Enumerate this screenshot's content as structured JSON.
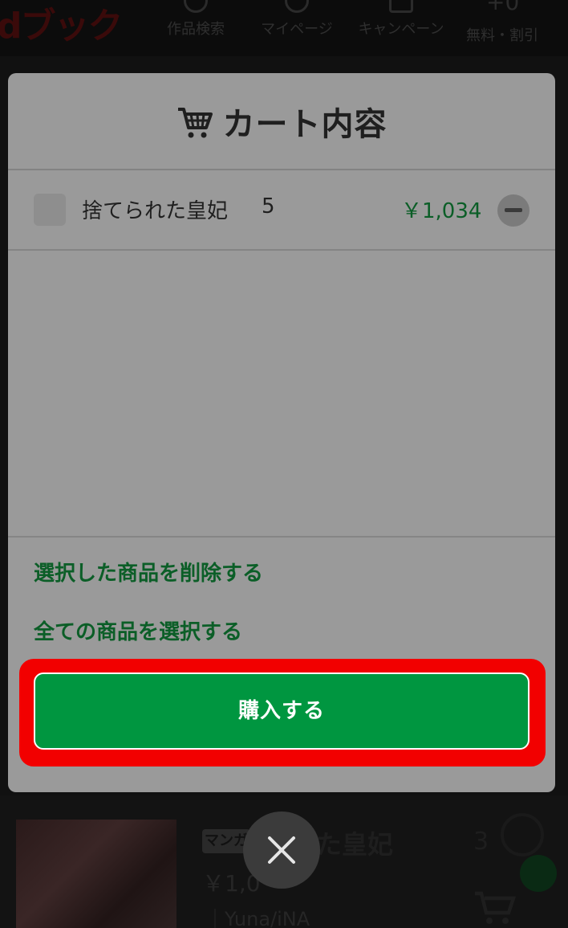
{
  "background": {
    "logo": "dブック",
    "nav": [
      {
        "label": "作品検索",
        "icon": "search-icon"
      },
      {
        "label": "マイページ",
        "icon": "user-icon"
      },
      {
        "label": "キャンペーン",
        "icon": "megaphone-icon"
      },
      {
        "label": "無料・割引",
        "icon": "zero-yen-icon",
        "badge": "+0"
      }
    ],
    "product": {
      "badge": "マンガ",
      "title": "られた皇妃",
      "volume": "3",
      "price": "￥1,0",
      "author": "｜Yuna/iNA"
    }
  },
  "cart": {
    "title": "カート内容",
    "items": [
      {
        "name": "捨てられた皇妃",
        "volume": "5",
        "price": "￥1,034"
      }
    ],
    "delete_selected": "選択した商品を削除する",
    "select_all": "全ての商品を選択する",
    "purchase": "購入する"
  },
  "colors": {
    "accent_green": "#009640",
    "link_green": "#0b5e27",
    "highlight_red": "#f20000",
    "modal_bg": "#9a9a9a"
  }
}
